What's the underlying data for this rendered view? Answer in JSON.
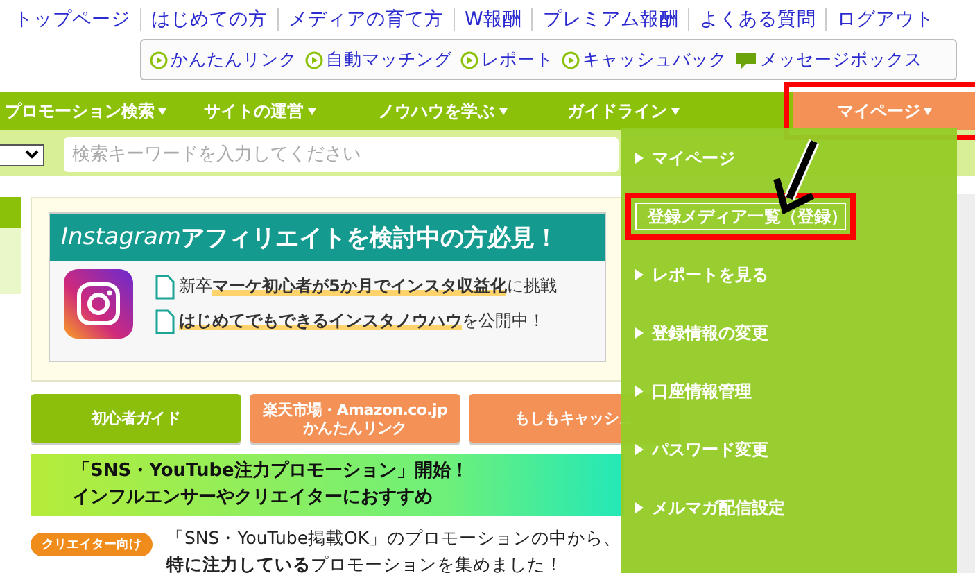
{
  "top_links": [
    "トップページ",
    "はじめての方",
    "メディアの育て方",
    "W報酬",
    "プレミアム報酬",
    "よくある質問",
    "ログアウト"
  ],
  "quick_links": [
    {
      "label": "かんたんリンク",
      "kind": "play"
    },
    {
      "label": "自動マッチング",
      "kind": "play"
    },
    {
      "label": "レポート",
      "kind": "play"
    },
    {
      "label": "キャッシュバック",
      "kind": "play"
    },
    {
      "label": "メッセージボックス",
      "kind": "message"
    }
  ],
  "nav": [
    {
      "label": "プロモーション検索",
      "selected": false,
      "highlighted": false
    },
    {
      "label": "サイトの運営",
      "selected": false,
      "highlighted": false
    },
    {
      "label": "ノウハウを学ぶ",
      "selected": false,
      "highlighted": false
    },
    {
      "label": "ガイドライン",
      "selected": false,
      "highlighted": false
    },
    {
      "label": "マイページ",
      "selected": true,
      "highlighted": true
    }
  ],
  "search": {
    "placeholder": "検索キーワードを入力してください"
  },
  "banner": {
    "title_latin": "Instagram",
    "title": "アフィリエイトを検討中の方必見！",
    "lines": [
      [
        {
          "text": "新卒",
          "marked": false
        },
        {
          "text": "マーケ初心者が5か月でインスタ収益化",
          "marked": true
        },
        {
          "text": "に挑戦",
          "marked": false
        }
      ],
      [
        {
          "text": "はじめてでもできるインスタノウハウ",
          "marked": true
        },
        {
          "text": "を公開中！",
          "marked": false
        }
      ]
    ]
  },
  "buttons": [
    {
      "label": "初心者ガイド",
      "color": "#8cbe0c"
    },
    {
      "label": "楽天市場・Amazon.co.jp\nかんたんリンク",
      "color": "#f39156"
    },
    {
      "label": "もしもキャッシュ",
      "color": "#f39156"
    }
  ],
  "promo_banner": {
    "line1": "「SNS・YouTube注力プロモーション」開始！",
    "line2": "インフルエンサーやクリエイターにおすすめ"
  },
  "creator": {
    "badge": "クリエイター向け",
    "line1": "「SNS・YouTube掲載OK」のプロモーションの中から、",
    "line2": "**特に注力している**プロモーションを集めました！"
  },
  "dropdown": [
    {
      "label": "マイページ",
      "highlighted": false
    },
    {
      "label": "登録メディア一覧（登録）",
      "highlighted": true
    },
    {
      "label": "レポートを見る",
      "highlighted": false
    },
    {
      "label": "登録情報の変更",
      "highlighted": false
    },
    {
      "label": "口座情報管理",
      "highlighted": false
    },
    {
      "label": "パスワード変更",
      "highlighted": false
    },
    {
      "label": "メルマガ配信設定",
      "highlighted": false
    }
  ]
}
